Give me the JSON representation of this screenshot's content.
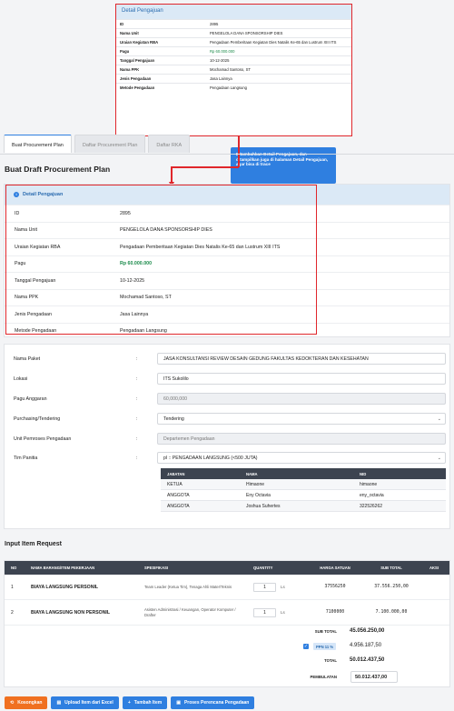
{
  "zoom": {
    "header": "Detail Pengajuan",
    "rows": [
      {
        "k": "ID",
        "v": "2895"
      },
      {
        "k": "Nama Unit",
        "v": "PENGELOLA DANA SPONSORSHIP DIES"
      },
      {
        "k": "Uraian Kegiatan RBA",
        "v": "Pengadaan Pemberitaan Kegiatan Dies Natalis Ke-65 dan Lustrum XIII ITS"
      },
      {
        "k": "Pagu",
        "v": "Rp 60.000.000"
      },
      {
        "k": "Tanggal Pengajuan",
        "v": "10-12-2025"
      },
      {
        "k": "Nama PPK",
        "v": "Mochamad Santoso, ST"
      },
      {
        "k": "Jenis Pengadaan",
        "v": "Jasa Lainnya"
      },
      {
        "k": "Metode Pengadaan",
        "v": "Pengadaan Langsung"
      }
    ]
  },
  "callout": "Ditambahkan Detail Pengajuan, dan ditampilkan juga di halaman Detail Pengajuan, agar bisa di trace",
  "tabs": [
    "Buat Procurement Plan",
    "Daftar Procurement Plan",
    "Daftar RKA"
  ],
  "page_title": "Buat Draft Procurement Plan",
  "detail": {
    "header": "Detail Pengajuan",
    "rows": [
      {
        "k": "ID",
        "v": "2895"
      },
      {
        "k": "Nama Unit",
        "v": "PENGELOLA DANA SPONSORSHIP DIES"
      },
      {
        "k": "Uraian Kegiatan RBA",
        "v": "Pengadaan Pemberitaan Kegiatan Dies Natalis Ke-65 dan Lustrum XIII ITS"
      },
      {
        "k": "Pagu",
        "v": "Rp 60.000.000"
      },
      {
        "k": "Tanggal Pengajuan",
        "v": "10-12-2025"
      },
      {
        "k": "Nama PPK",
        "v": "Mochamad Santoso, ST"
      },
      {
        "k": "Jenis Pengadaan",
        "v": "Jasa Lainnya"
      },
      {
        "k": "Metode Pengadaan",
        "v": "Pengadaan Langsung"
      }
    ]
  },
  "form": {
    "colon": ":",
    "nama_paket": {
      "label": "Nama Paket",
      "value": "JASA KONSULTANSI REVIEW DESAIN GEDUNG FAKULTAS KEDOKTERAN DAN KESEHATAN"
    },
    "lokasi": {
      "label": "Lokasi",
      "value": "ITS Sukolilo"
    },
    "pagu_anggaran": {
      "label": "Pagu Anggaran",
      "value": "60,000,000"
    },
    "purchasing": {
      "label": "Purchasing/Tendering",
      "value": "Tendering"
    },
    "unit_pemroses": {
      "label": "Unit Pemroses Pengadaan",
      "value": "Departemen Pengadaan"
    },
    "tim_panitia": {
      "label": "Tim Panitia",
      "value": "pl :: PENGADAAN LANGSUNG (<500 JUTA)"
    }
  },
  "panitia": {
    "headers": [
      "JABATAN",
      "NAMA",
      "NID"
    ],
    "rows": [
      [
        "KETUA",
        "Himaone",
        "himaone"
      ],
      [
        "ANGGOTA",
        "Eny Octavia",
        "eny_octavia"
      ],
      [
        "ANGGOTA",
        "Joshua Suhertes",
        "322526262"
      ]
    ]
  },
  "items_title": "Input Item Request",
  "items": {
    "headers": [
      "NO",
      "NAMA BARANG/ITEM PEKERJAAN",
      "SPESIFIKASI",
      "QUANTITY",
      "HARGA SATUAN",
      "SUB TOTAL",
      "AKSI"
    ],
    "rows": [
      {
        "no": "1",
        "nama": "BIAYA LANGSUNG PERSONIL",
        "spek": "Team Leader (Ketua Tim), Tenaga Ahli Mater/Teknis",
        "qty": "1",
        "unit": "Ls",
        "harga": "37556250",
        "sub": "37.556.250,00"
      },
      {
        "no": "2",
        "nama": "BIAYA LANGSUNG NON PERSONIL",
        "spek": "Asisten Administrasi / Keuangan, Operator Komputer / Drafter",
        "qty": "1",
        "unit": "Ls",
        "harga": "7100000",
        "sub": "7.100.000,00"
      }
    ],
    "sub_total_label": "SUB TOTAL",
    "sub_total": "45.056.250,00",
    "ppn_label": "PPN 11 %",
    "ppn": "4.956.187,50",
    "total_label": "TOTAL",
    "total": "50.012.437,50",
    "pembulatan_label": "PEMBULATAN",
    "pembulatan": "50.012.437,00"
  },
  "buttons": {
    "reset": "Kosongkan",
    "upload": "Upload Item dari Excel",
    "add": "Tambah Item",
    "process": "Proses Perencana Pengadaan"
  }
}
